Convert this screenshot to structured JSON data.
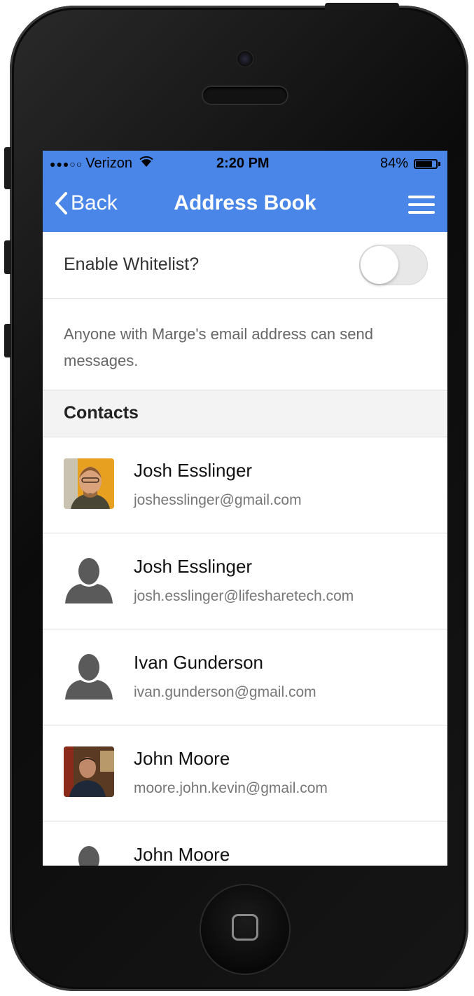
{
  "status_bar": {
    "signal_dots": "●●●○○",
    "carrier": "Verizon",
    "time": "2:20 PM",
    "battery_percent": "84%",
    "battery_level": 0.84
  },
  "nav": {
    "back_label": "Back",
    "title": "Address Book"
  },
  "whitelist": {
    "label": "Enable Whitelist?",
    "enabled": false
  },
  "info_text": "Anyone with Marge's email address can send messages.",
  "contacts_header": "Contacts",
  "contacts": [
    {
      "name": "Josh Esslinger",
      "email": "joshesslinger@gmail.com",
      "avatar": "photo"
    },
    {
      "name": "Josh Esslinger",
      "email": "josh.esslinger@lifesharetech.com",
      "avatar": "placeholder"
    },
    {
      "name": "Ivan Gunderson",
      "email": "ivan.gunderson@gmail.com",
      "avatar": "placeholder"
    },
    {
      "name": "John Moore",
      "email": "moore.john.kevin@gmail.com",
      "avatar": "photo"
    },
    {
      "name": "John Moore",
      "email": "",
      "avatar": "placeholder"
    }
  ],
  "colors": {
    "accent": "#4a86e8",
    "text_secondary": "#777777"
  }
}
